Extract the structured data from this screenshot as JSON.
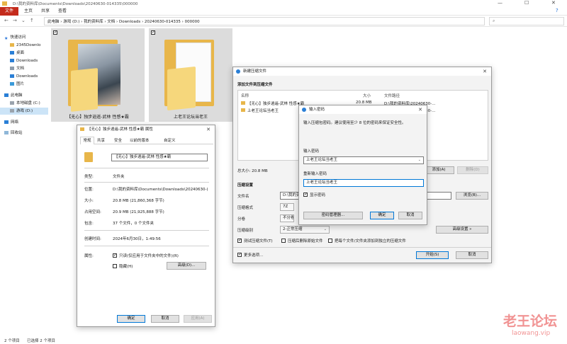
{
  "window": {
    "path_title": "D:\\我的资料库\\Documents\\Downloads\\20240630-014335\\000000"
  },
  "ribbon": {
    "file_tab": "文件",
    "tabs": [
      "主页",
      "共享",
      "查看"
    ]
  },
  "addressbar": {
    "crumbs": [
      "此电脑",
      "游戏 (D:)",
      "我的资料库",
      "文档",
      "Downloads",
      "20240630-014335",
      "000000"
    ]
  },
  "sidebar": {
    "items": [
      {
        "label": "快速访问",
        "icon": "star-icon"
      },
      {
        "label": "2345Downlo",
        "icon": "folder-icon"
      },
      {
        "label": "桌面",
        "icon": "desktop-icon"
      },
      {
        "label": "Downloads",
        "icon": "download-icon"
      },
      {
        "label": "文档",
        "icon": "document-icon"
      },
      {
        "label": "Downloads",
        "icon": "download-icon"
      },
      {
        "label": "图片",
        "icon": "picture-icon"
      },
      {
        "label": "此电脑",
        "icon": "computer-icon"
      },
      {
        "label": "本地磁盘 (C:)",
        "icon": "drive-icon"
      },
      {
        "label": "游戏 (D:)",
        "icon": "drive-icon"
      },
      {
        "label": "网络",
        "icon": "network-icon"
      },
      {
        "label": "回收站",
        "icon": "recycle-bin-icon"
      }
    ]
  },
  "files": [
    {
      "name": "【无心】独步逍遥-武林 性感★霸"
    },
    {
      "name": "上老王论坛当老王"
    }
  ],
  "statusbar": {
    "count": "2 个项目",
    "selected": "已选择 2 个项目"
  },
  "props": {
    "title": "【无心】独步逍遥-武林 性感★霸 属性",
    "tabs": [
      "常规",
      "共享",
      "安全",
      "以前的版本",
      "自定义"
    ],
    "name_value": "【无心】独步逍遥-武林 性感★霸",
    "rows": [
      {
        "label": "类型:",
        "value": "文件夹"
      },
      {
        "label": "位置:",
        "value": "D:\\我的资料库\\Documents\\Downloads\\20240630-("
      },
      {
        "label": "大小:",
        "value": "20.8 MB (21,860,368 字节)"
      },
      {
        "label": "占用空间:",
        "value": "20.9 MB (21,925,888 字节)"
      },
      {
        "label": "包含:",
        "value": "37 个文件，0 个文件夹"
      },
      {
        "label": "创建时间:",
        "value": "2024年6月30日，1:49:56"
      }
    ],
    "attr_label": "属性:",
    "readonly_label": "只读(仅应用于文件夹中的文件)(R)",
    "hidden_label": "隐藏(H)",
    "advanced_button": "高级(D)...",
    "ok": "确定",
    "cancel": "取消",
    "apply": "应用(A)"
  },
  "archive": {
    "title": "新建压缩文件",
    "section_add": "添加文件到压缩文件",
    "col_name": "名称",
    "col_size": "大小",
    "col_path": "文件路径",
    "files": [
      {
        "name": "【无心】独步逍遥-武林 性感★霸",
        "size": "20.8 MB",
        "path": "D:\\我的资料库\\20240630-..."
      },
      {
        "name": "上老王论坛当老王",
        "size": "",
        "path": "D:\\我的资料库\\20240630-..."
      }
    ],
    "total": "总大小: 20.8 MB",
    "add_button": "添加(A)",
    "remove_button": "删除(D)",
    "section_settings": "压缩设置",
    "filename_label": "文件名",
    "filename_value": "D:\\我的资料",
    "browse_button": "浏览(B)...",
    "format_label": "压缩格式",
    "format_value": "7Z",
    "split_label": "分卷",
    "split_value": "不分卷",
    "level_label": "压缩级别",
    "level_value": "2-正常压缩",
    "advanced_button": "高级设置 »",
    "opt_test": "测试压缩文件(T)",
    "opt_delete": "压缩后删除原始文件",
    "opt_each": "把每个文件/文件夹添加到独立的压缩文件",
    "more_options": "更多选项...",
    "start_button": "开始(S)",
    "cancel_button": "取消"
  },
  "password": {
    "title": "输入密码",
    "hint": "输入压缩包密码。建议使用至少 8 位的密码来保证安全性。",
    "enter_label": "输入密码",
    "enter_value": "上老王论坛当老王",
    "reenter_label": "重新输入密码",
    "reenter_value": "上老王论坛当老王",
    "show_label": "显示密码",
    "manager_button": "密码管理器...",
    "ok_button": "确定",
    "cancel_button": "取消"
  },
  "watermark": {
    "title": "老王论坛",
    "url": "laowang.vip"
  }
}
